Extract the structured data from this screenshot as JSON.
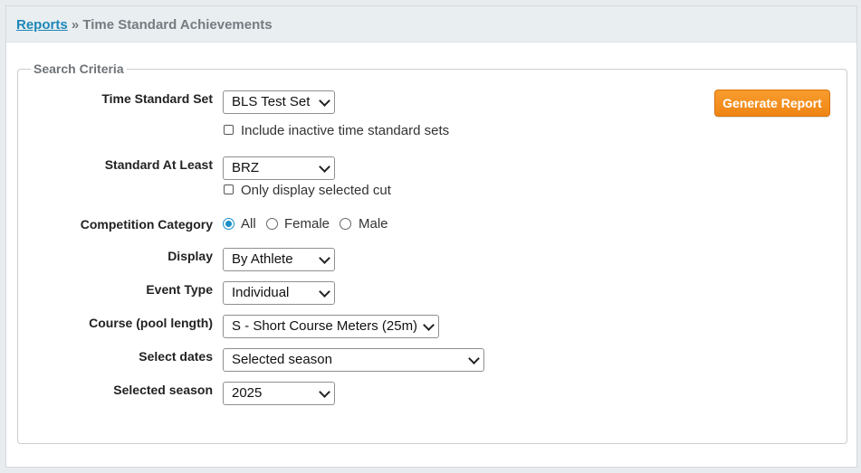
{
  "breadcrumb": {
    "link": "Reports",
    "separator": "»",
    "current": "Time Standard Achievements"
  },
  "search": {
    "legend": "Search Criteria",
    "generate_label": "Generate Report",
    "time_standard_set": {
      "label": "Time Standard Set",
      "value": "BLS Test Set",
      "checkbox_label": "Include inactive time standard sets",
      "checked": false
    },
    "standard_at_least": {
      "label": "Standard At Least",
      "value": "BRZ",
      "checkbox_label": "Only display selected cut",
      "checked": false
    },
    "competition_category": {
      "label": "Competition Category",
      "options": [
        "All",
        "Female",
        "Male"
      ],
      "selected": "All"
    },
    "display": {
      "label": "Display",
      "value": "By Athlete"
    },
    "event_type": {
      "label": "Event Type",
      "value": "Individual"
    },
    "course": {
      "label": "Course (pool length)",
      "value": "S - Short Course Meters (25m)"
    },
    "select_dates": {
      "label": "Select dates",
      "value": "Selected season"
    },
    "selected_season": {
      "label": "Selected season",
      "value": "2025"
    }
  },
  "colors": {
    "link": "#1d87b8",
    "button": "#f28a1a",
    "radio_selected": "#1a8fc6"
  }
}
